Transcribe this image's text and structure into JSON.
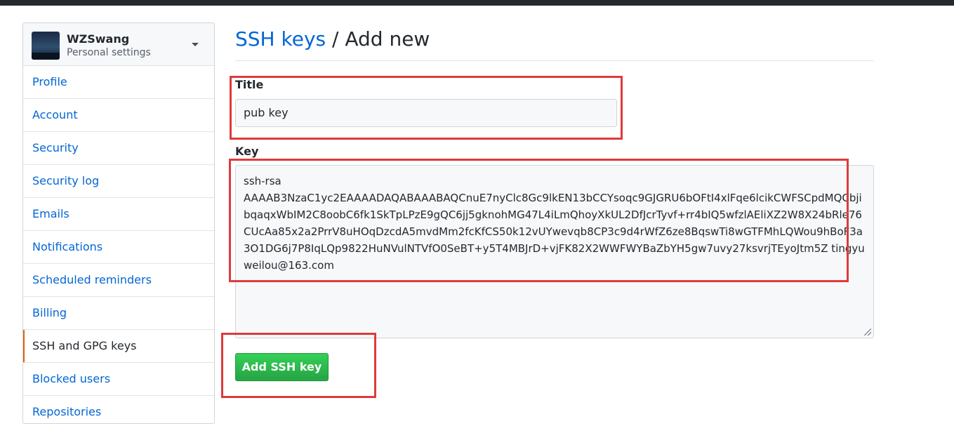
{
  "user": {
    "name": "WZSwang",
    "subtitle": "Personal settings"
  },
  "sidebar": {
    "items": [
      {
        "label": "Profile"
      },
      {
        "label": "Account"
      },
      {
        "label": "Security"
      },
      {
        "label": "Security log"
      },
      {
        "label": "Emails"
      },
      {
        "label": "Notifications"
      },
      {
        "label": "Scheduled reminders"
      },
      {
        "label": "Billing"
      },
      {
        "label": "SSH and GPG keys",
        "selected": true
      },
      {
        "label": "Blocked users"
      },
      {
        "label": "Repositories"
      }
    ]
  },
  "page": {
    "breadcrumb_link": "SSH keys",
    "breadcrumb_sep": " / ",
    "breadcrumb_current": "Add new"
  },
  "form": {
    "title_label": "Title",
    "title_value": "pub key",
    "key_label": "Key",
    "key_value": "ssh-rsa\nAAAAB3NzaC1yc2EAAAADAQABAAABAQCnuE7nyClc8Gc9lkEN13bCCYsoqc9GJGRU6bOFtI4xlFqe6lcikCWFSCpdMQCbjibqaqxWbIM2C8oobC6fk1SkTpLPzE9gQC6jj5gknohMG47L4iLmQhoyXkUL2DfJcrTyvf+rr4bIQ5wfzlAEliXZ2W8X24bRle76CUcAa85x2a2PrrV8uHOqDzcdA5mvdMm2fcKfCS50k12vUYwevqb8CP3c9d4rWfZ6ze8BqswTi8wGTFMhLQWou9hBoF3a3O1DG6j7P8IqLQp9822HuNVulNTVfO0SeBT+y5T4MBJrD+vjFK82X2WWFWYBaZbYH5gw7uvy27ksvrjTEyoJtm5Z tingyuweilou@163.com",
    "submit_label": "Add SSH key"
  },
  "colors": {
    "link": "#0366d6",
    "button_green": "#28a745",
    "highlight_red": "#e03a3a",
    "selected_marker": "#e36209"
  },
  "icons": {
    "avatar": "avatar-image",
    "dropdown": "caret-down-icon",
    "resize": "resize-grip-icon"
  }
}
